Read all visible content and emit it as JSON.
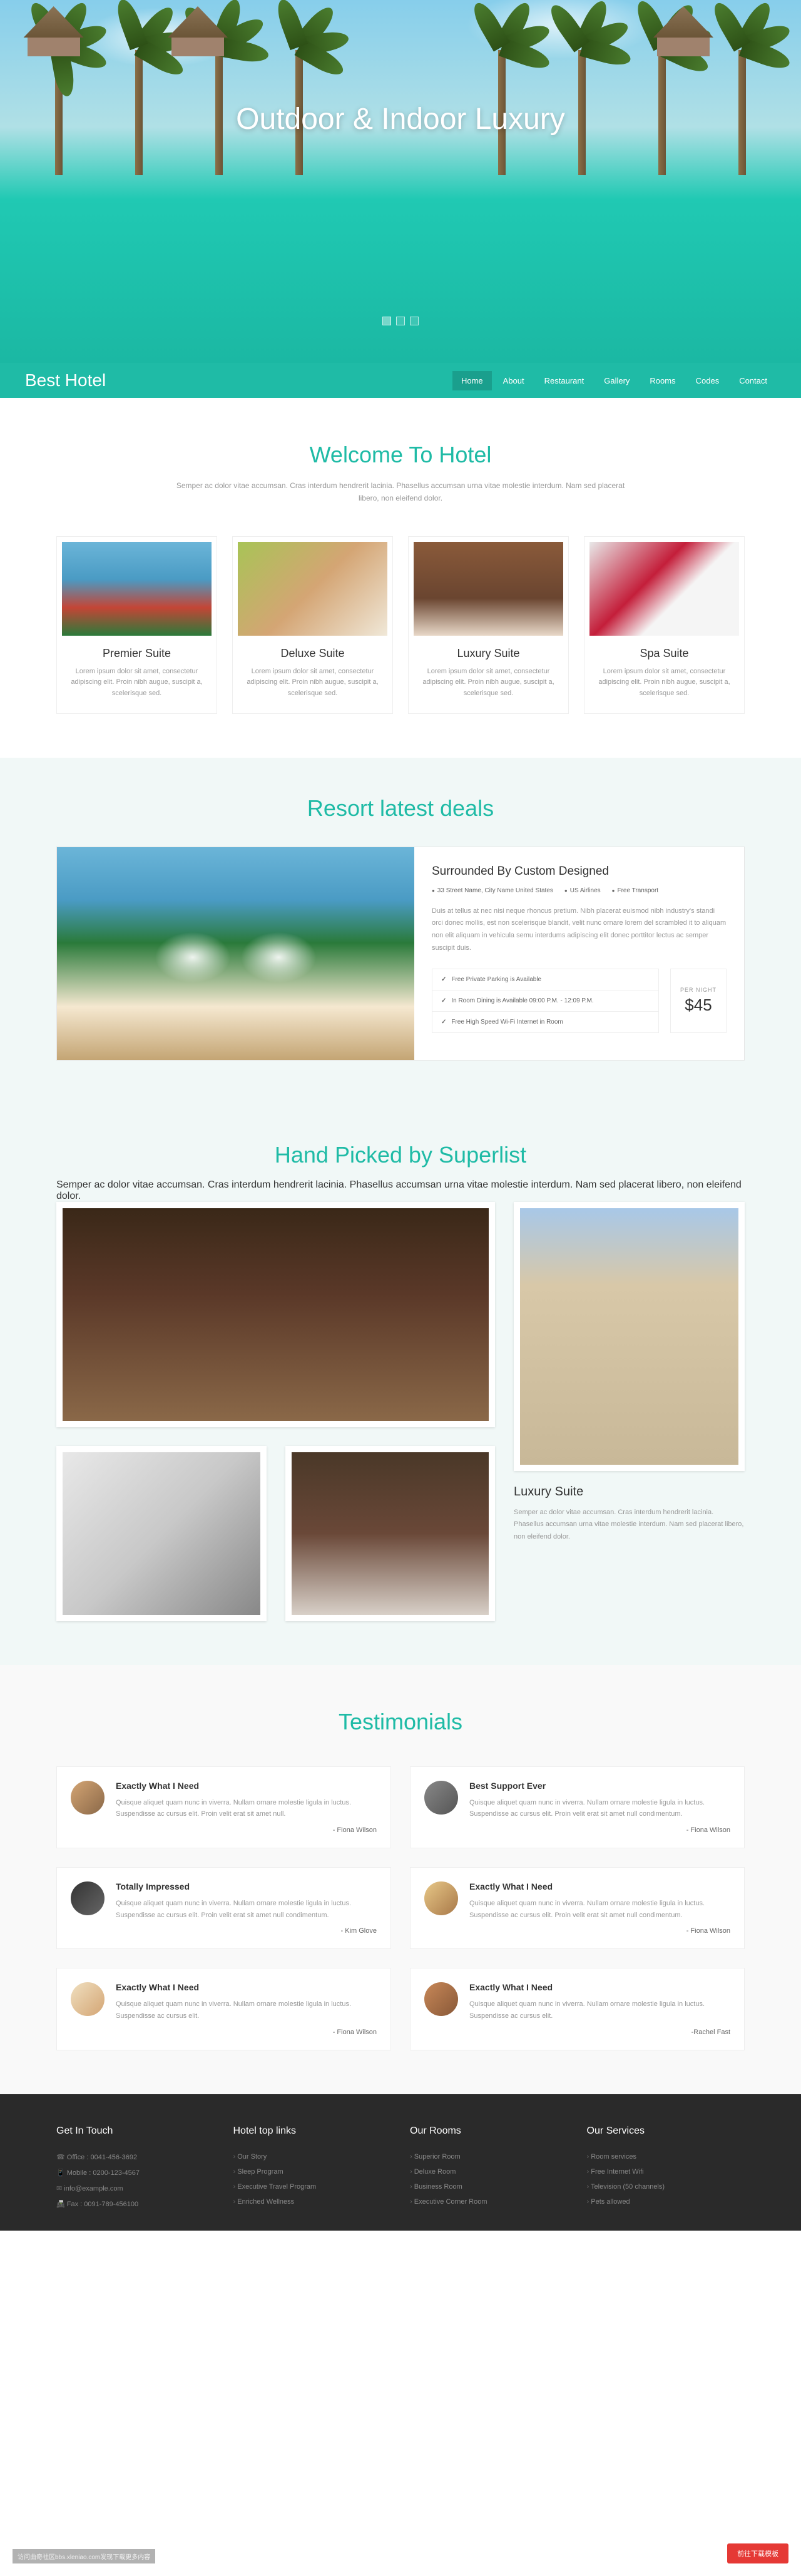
{
  "hero": {
    "title": "Outdoor & Indoor Luxury"
  },
  "nav": {
    "brand": "Best Hotel",
    "items": [
      "Home",
      "About",
      "Restaurant",
      "Gallery",
      "Rooms",
      "Codes",
      "Contact"
    ]
  },
  "welcome": {
    "title": "Welcome To Hotel",
    "subtitle": "Semper ac dolor vitae accumsan. Cras interdum hendrerit lacinia. Phasellus accumsan urna vitae molestie interdum. Nam sed placerat libero, non eleifend dolor.",
    "suites": [
      {
        "name": "Premier Suite",
        "desc": "Lorem ipsum dolor sit amet, consectetur adipiscing elit. Proin nibh augue, suscipit a, scelerisque sed."
      },
      {
        "name": "Deluxe Suite",
        "desc": "Lorem ipsum dolor sit amet, consectetur adipiscing elit. Proin nibh augue, suscipit a, scelerisque sed."
      },
      {
        "name": "Luxury Suite",
        "desc": "Lorem ipsum dolor sit amet, consectetur adipiscing elit. Proin nibh augue, suscipit a, scelerisque sed."
      },
      {
        "name": "Spa Suite",
        "desc": "Lorem ipsum dolor sit amet, consectetur adipiscing elit. Proin nibh augue, suscipit a, scelerisque sed."
      }
    ]
  },
  "deals": {
    "title": "Resort latest deals",
    "heading": "Surrounded By Custom Designed",
    "meta": [
      "33 Street Name, City Name United States",
      "US Airlines",
      "Free Transport"
    ],
    "desc": "Duis at tellus at nec nisi neque rhoncus pretium. Nibh placerat euismod nibh industry's standi orci donec mollis, est non scelerisque blandit, velit nunc ornare lorem del scrambled it to aliquam non elit aliquam in vehicula semu interdums adipiscing elit donec porttitor lectus ac semper suscipit duis.",
    "features": [
      "Free Private Parking is Available",
      "In Room Dining is Available 09:00 P.M. - 12:09 P.M.",
      "Free High Speed Wi-Fi Internet in Room"
    ],
    "price_label": "PER NIGHT",
    "price": "$45"
  },
  "handpick": {
    "title": "Hand Picked by Superlist",
    "subtitle": "Semper ac dolor vitae accumsan. Cras interdum hendrerit lacinia. Phasellus accumsan urna vitae molestie interdum. Nam sed placerat libero, non eleifend dolor.",
    "card_title": "Luxury Suite",
    "card_desc": "Semper ac dolor vitae accumsan. Cras interdum hendrerit lacinia. Phasellus accumsan urna vitae molestie interdum. Nam sed placerat libero, non eleifend dolor."
  },
  "testimonials": {
    "title": "Testimonials",
    "items": [
      {
        "title": "Exactly What I Need",
        "text": "Quisque aliquet quam nunc in viverra. Nullam ornare molestie ligula in luctus. Suspendisse ac cursus elit. Proin velit erat sit amet null.",
        "author": "- Fiona Wilson"
      },
      {
        "title": "Best Support Ever",
        "text": "Quisque aliquet quam nunc in viverra. Nullam ornare molestie ligula in luctus. Suspendisse ac cursus elit. Proin velit erat sit amet null condimentum.",
        "author": "- Fiona Wilson"
      },
      {
        "title": "Totally Impressed",
        "text": "Quisque aliquet quam nunc in viverra. Nullam ornare molestie ligula in luctus. Suspendisse ac cursus elit. Proin velit erat sit amet null condimentum.",
        "author": "- Kim Glove"
      },
      {
        "title": "Exactly What I Need",
        "text": "Quisque aliquet quam nunc in viverra. Nullam ornare molestie ligula in luctus. Suspendisse ac cursus elit. Proin velit erat sit amet null condimentum.",
        "author": "- Fiona Wilson"
      },
      {
        "title": "Exactly What I Need",
        "text": "Quisque aliquet quam nunc in viverra. Nullam ornare molestie ligula in luctus. Suspendisse ac cursus elit.",
        "author": "- Fiona Wilson"
      },
      {
        "title": "Exactly What I Need",
        "text": "Quisque aliquet quam nunc in viverra. Nullam ornare molestie ligula in luctus. Suspendisse ac cursus elit.",
        "author": "-Rachel Fast"
      }
    ]
  },
  "footer": {
    "contact": {
      "title": "Get In Touch",
      "items": [
        "Office : 0041-456-3692",
        "Mobile : 0200-123-4567",
        "info@example.com",
        "Fax : 0091-789-456100"
      ]
    },
    "links": {
      "title": "Hotel top links",
      "items": [
        "Our Story",
        "Sleep Program",
        "Executive Travel Program",
        "Enriched Wellness"
      ]
    },
    "rooms": {
      "title": "Our Rooms",
      "items": [
        "Superior Room",
        "Deluxe Room",
        "Business Room",
        "Executive Corner Room"
      ]
    },
    "services": {
      "title": "Our Services",
      "items": [
        "Room services",
        "Free Internet Wifi",
        "Television (50 channels)",
        "Pets allowed"
      ]
    }
  },
  "floats": {
    "download": "前往下载模板",
    "note": "访问曲奇社区bbs.xleniao.com发现下载更多内容"
  }
}
